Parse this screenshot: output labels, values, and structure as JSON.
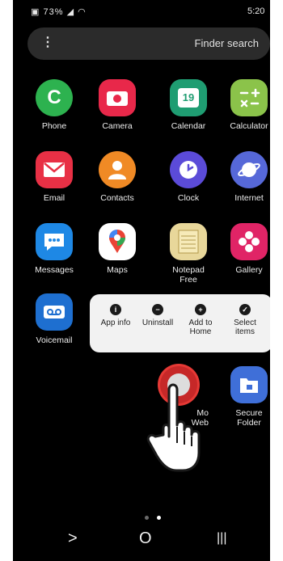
{
  "status": {
    "time": "5:20",
    "battery": "73%"
  },
  "search": {
    "placeholder": "Finder search",
    "menu_glyph": "⋮"
  },
  "apps": [
    {
      "label": "Calculator",
      "icon": "calculator-icon",
      "color": "#8bc34a"
    },
    {
      "label": "Calendar",
      "icon": "calendar-icon",
      "color": "#1f9d72",
      "glyph": "19"
    },
    {
      "label": "Camera",
      "icon": "camera-icon",
      "color": "#e8284a"
    },
    {
      "label": "Phone",
      "icon": "phone-icon",
      "color": "#2db24f"
    },
    {
      "label": "Internet",
      "icon": "internet-icon",
      "color": "#5668d8"
    },
    {
      "label": "Clock",
      "icon": "clock-icon",
      "color": "#5b4bd8"
    },
    {
      "label": "Contacts",
      "icon": "contacts-icon",
      "color": "#f08a25"
    },
    {
      "label": "Email",
      "icon": "email-icon",
      "color": "#e83045"
    },
    {
      "label": "Gallery",
      "icon": "gallery-icon",
      "color": "#e02466"
    },
    {
      "label": "Notepad\nFree",
      "icon": "notepad-icon",
      "color": "#e8d79a"
    },
    {
      "label": "Maps",
      "icon": "maps-icon",
      "color": "#ffffff"
    },
    {
      "label": "Messages",
      "icon": "messages-icon",
      "color": "#1e88e5"
    },
    {
      "label": "Voicemail",
      "icon": "voicemail-icon",
      "color": "#1e6fd0"
    },
    {
      "label": "Secure\nFolder",
      "icon": "secure-folder-icon",
      "color": "#3f6fd8"
    },
    {
      "label": "Mo\nWeb",
      "icon": "selected-app-icon",
      "color": "#c62828"
    }
  ],
  "context_menu": [
    {
      "label": "Select\nitems",
      "icon": "select-items-icon",
      "glyph": "✓"
    },
    {
      "label": "Add to\nHome",
      "icon": "add-home-icon",
      "glyph": "+"
    },
    {
      "label": "Uninstall",
      "icon": "uninstall-icon",
      "glyph": "−"
    },
    {
      "label": "App info",
      "icon": "app-info-icon",
      "glyph": "i"
    }
  ],
  "nav": {
    "recents": "|||",
    "home": "O",
    "back": ">"
  },
  "pager": {
    "colors": [
      "#ffffff",
      "#6a6a6a"
    ]
  }
}
